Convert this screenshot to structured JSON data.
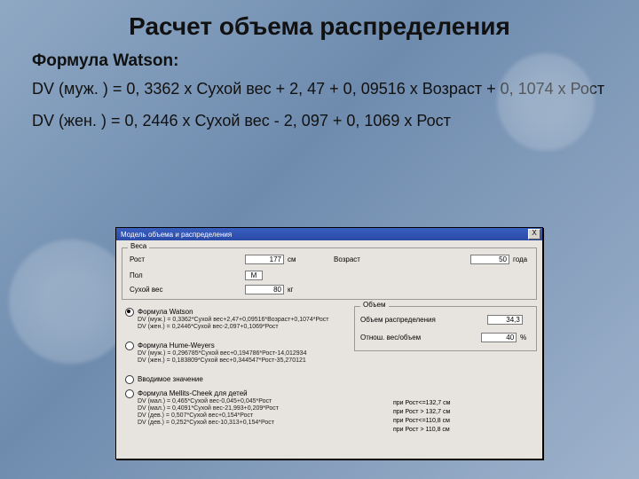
{
  "title": "Расчет объема распределения",
  "subtitle": "Формула Watson:",
  "formula_male": "DV (муж. ) = 0, 3362 х Сухой вес + 2, 47 + 0, 09516 х Возраст + 0, 1074 х Рост",
  "formula_female": "DV (жен. ) = 0, 2446 х Сухой вес - 2, 097 + 0, 1069 х Рост",
  "dialog": {
    "title": "Модель объема и распределения",
    "close": "X",
    "group_weight": {
      "legend": "Веса"
    },
    "fields": {
      "height": {
        "label": "Рост",
        "value": "177",
        "unit": "см"
      },
      "age": {
        "label": "Возраст",
        "value": "50",
        "unit": "года"
      },
      "gender": {
        "label": "Пол",
        "value": "М"
      },
      "dryweight": {
        "label": "Сухой вес",
        "value": "80",
        "unit": "кг"
      }
    },
    "options": {
      "o1": {
        "label": "Формула Watson",
        "l1": "DV (муж.) = 0,3362*Сухой вес+2,47+0,09516*Возраст+0,1074*Рост",
        "l2": "DV (жен.) = 0,2446*Сухой вес-2,097+0,1069*Рост"
      },
      "o2": {
        "label": "Формула Hume-Weyers",
        "l1": "DV (муж.) = 0,296785*Сухой вес+0,194786*Рост-14,012934",
        "l2": "DV (жен.) = 0,183809*Сухой вес+0,344547*Рост-35,270121"
      },
      "o3": {
        "label": "Вводимое значение"
      },
      "o4": {
        "label": "Формула Mellits-Cheek для детей",
        "l1": "DV (мал.) = 0,465*Сухой вес-0,045+0,045*Рост",
        "l2": "DV (мал.) = 0,4091*Сухой вес-21,993+0,209*Рост",
        "l3": "DV (дев.) = 0,507*Сухой вес+0,154*Рост",
        "l4": "DV (дев.) = 0,252*Сухой вес-10,313+0,154*Рост",
        "n1": "при Рост<=132,7 см",
        "n2": "при Рост > 132,7 см",
        "n3": "при Рост<=110,8 см",
        "n4": "при Рост > 110,8 см"
      }
    },
    "result": {
      "legend": "Объем",
      "dv_label": "Объем распределения",
      "dv_value": "34,3",
      "ratio_label": "Отнош. вес/объем",
      "ratio_value": "40",
      "ratio_unit": "%"
    }
  }
}
